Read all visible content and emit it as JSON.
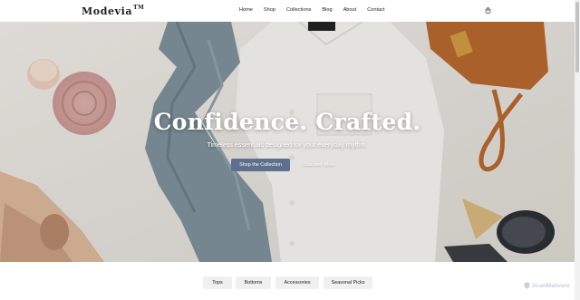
{
  "brand": {
    "logo": "Modevia",
    "trademark": "TM"
  },
  "nav": {
    "items": [
      {
        "label": "Home"
      },
      {
        "label": "Shop"
      },
      {
        "label": "Collections"
      },
      {
        "label": "Blog"
      },
      {
        "label": "About"
      },
      {
        "label": "Contact"
      }
    ]
  },
  "header": {
    "cart_icon": "bag-icon"
  },
  "hero": {
    "title": "Confidence. Crafted.",
    "subtitle": "Timeless essentials designed for your everyday rhythm.",
    "primary_button": "Shop the Collection",
    "secondary_button": "Discover More"
  },
  "categories": {
    "items": [
      {
        "label": "Tops"
      },
      {
        "label": "Bottoms"
      },
      {
        "label": "Accessories"
      },
      {
        "label": "Seasonal Picks"
      }
    ]
  },
  "watermark": {
    "text": "ScanMalware"
  },
  "colors": {
    "accent": "#5f6f8e",
    "hero_bg": "#e4e1dc",
    "category_bg": "#f0f0f0"
  }
}
